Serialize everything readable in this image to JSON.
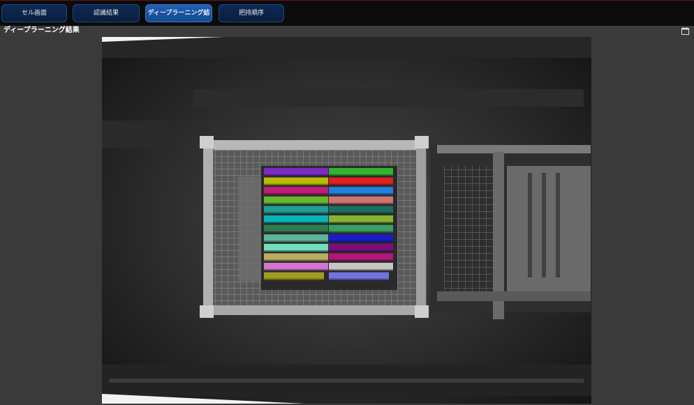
{
  "tabs": [
    {
      "label": "セル画面",
      "active": false
    },
    {
      "label": "認識結果",
      "active": false
    },
    {
      "label": "ディープラーニング結果",
      "active": true
    },
    {
      "label": "把持順序",
      "active": false
    }
  ],
  "section": {
    "title": "ディープラーニング結果"
  },
  "detections": {
    "count": 24,
    "colors": [
      "#8a2be2",
      "#32cd32",
      "#d4d400",
      "#ff2020",
      "#d81b8a",
      "#1e90ff",
      "#6fd12e",
      "#f08080",
      "#20b2aa",
      "#1a7a6a",
      "#00ced1",
      "#9acd32",
      "#2e8b57",
      "#3cb371",
      "#66cdaa",
      "#1a1ae0",
      "#7fffd4",
      "#8b0a8b",
      "#d2c46a",
      "#c71585",
      "#ee82ee",
      "#e0e0e0",
      "#b5b020",
      "#8080ff"
    ]
  },
  "icons": {
    "window": "window-icon"
  }
}
